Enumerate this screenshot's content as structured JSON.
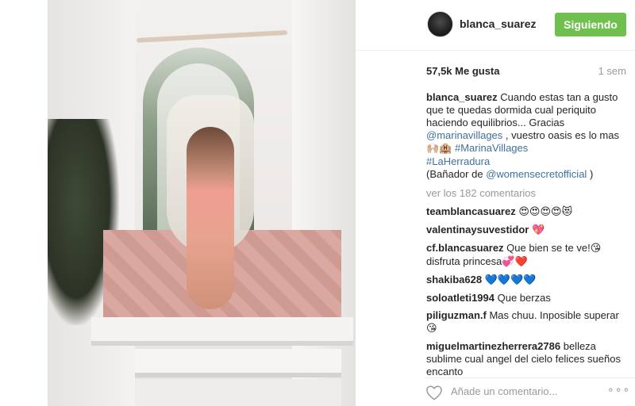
{
  "post": {
    "username": "blanca_suarez",
    "follow_label": "Siguiendo",
    "likes": "57,5k Me gusta",
    "time": "1 sem",
    "caption": {
      "username": "blanca_suarez",
      "text1": "Cuando estas tan a gusto que te quedas dormida cual periquito haciendo equilibrios... Gracias",
      "mention1": "@marinavillages",
      "text2": ", vuestro oasis es lo mas",
      "emoji": "🙌🏼🏨",
      "hashtag1": "#MarinaVillages",
      "hashtag2": "#LaHerradura",
      "text3": "(Bañador de",
      "mention2": "@womensecretofficial",
      "text4": ")"
    },
    "view_comments": "ver los 182 comentarios",
    "comments": [
      {
        "user": "teamblancasuarez",
        "text": "",
        "emoji": "😍😍😍😍😻"
      },
      {
        "user": "valentinaysuvestidor",
        "text": "",
        "emoji": "💖"
      },
      {
        "user": "cf.blancasuarez",
        "text": "Que bien se te ve!",
        "emoji": "😘",
        "text_b": "disfruta princesa",
        "emoji_b": "💞❤️"
      },
      {
        "user": "shakiba628",
        "text": "",
        "emoji": "💙💙💙💙"
      },
      {
        "user": "soloatleti1994",
        "text": "Que berzas",
        "emoji": ""
      },
      {
        "user": "piliguzman.f",
        "text": "Mas chuu. Inposible superar",
        "emoji": "😘"
      },
      {
        "user": "miguelmartinezherrera2786",
        "text": "belleza sublime cual angel del cielo felices sueños encanto",
        "emoji": ""
      }
    ],
    "add_comment_placeholder": "Añade un comentario...",
    "more_options": "∘∘∘"
  },
  "colors": {
    "follow_bg": "#70c050",
    "link": "#3f729b",
    "muted": "#999999",
    "text": "#262626"
  },
  "icons": [
    "heart-icon",
    "more-options-icon"
  ]
}
